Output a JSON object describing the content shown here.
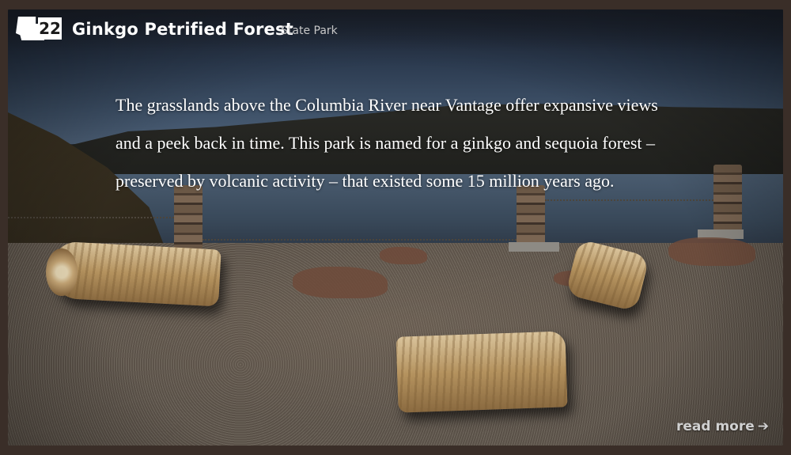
{
  "header": {
    "badge_number": "22",
    "badge_icon": "washington-state-icon",
    "title": "Ginkgo Petrified Forest",
    "subtitle": "State Park"
  },
  "main": {
    "description": "The grasslands above the Columbia River near Vantage offer expansive views and a peek back in time. This park is named for a ginkgo and sequoia forest – preserved by volcanic activity – that existed some 15 million years ago."
  },
  "footer": {
    "read_more_label": "read more",
    "read_more_icon": "arrow-right-icon"
  },
  "colors": {
    "frame": "#3a2e28",
    "text": "#ffffff",
    "subtitle": "#c8c8c8"
  }
}
